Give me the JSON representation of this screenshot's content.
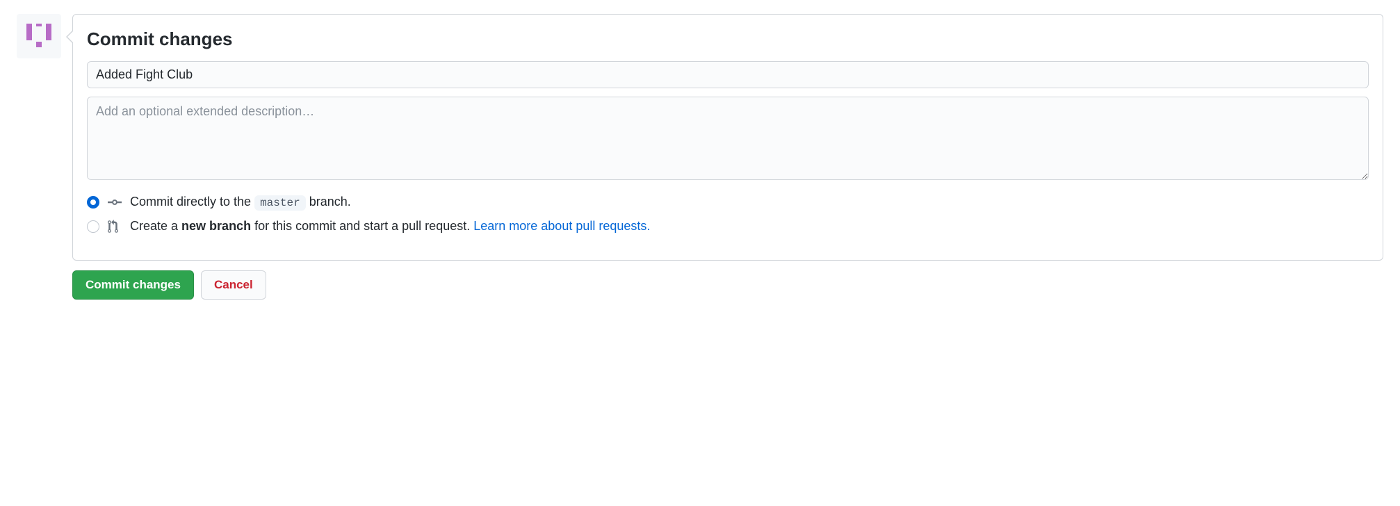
{
  "heading": "Commit changes",
  "summary_value": "Added Fight Club",
  "description_placeholder": "Add an optional extended description…",
  "option_direct": {
    "pre": "Commit directly to the ",
    "branch": "master",
    "post": " branch."
  },
  "option_newbranch": {
    "pre": "Create a ",
    "bold": "new branch",
    "post": " for this commit and start a pull request. ",
    "link": "Learn more about pull requests."
  },
  "buttons": {
    "commit": "Commit changes",
    "cancel": "Cancel"
  }
}
